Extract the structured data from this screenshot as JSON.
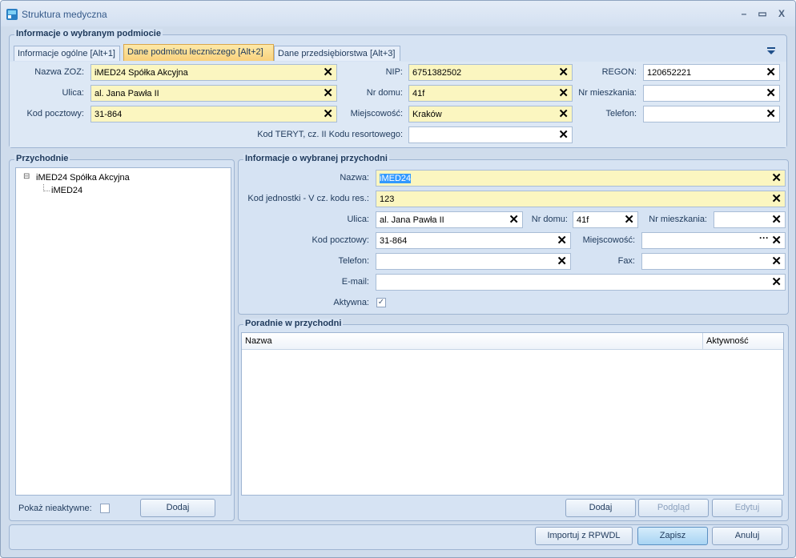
{
  "window": {
    "title": "Struktura medyczna",
    "controls": [
      "–",
      "▭",
      "X"
    ]
  },
  "entity_group": {
    "legend": "Informacje o wybranym podmiocie",
    "tabs": [
      {
        "label": "Informacje ogólne [Alt+1]",
        "active": false
      },
      {
        "label": "Dane podmiotu leczniczego [Alt+2]",
        "active": true
      },
      {
        "label": "Dane przedsiębiorstwa [Alt+3]",
        "active": false
      }
    ],
    "fields": {
      "nazwa_zoz": {
        "label": "Nazwa ZOZ:",
        "value": "iMED24 Spółka Akcyjna"
      },
      "ulica": {
        "label": "Ulica:",
        "value": "al. Jana Pawła II"
      },
      "kod_pocztowy": {
        "label": "Kod pocztowy:",
        "value": "31-864"
      },
      "nip": {
        "label": "NIP:",
        "value": "6751382502"
      },
      "nr_domu": {
        "label": "Nr domu:",
        "value": "41f"
      },
      "miejscowosc": {
        "label": "Miejscowość:",
        "value": "Kraków"
      },
      "regon": {
        "label": "REGON:",
        "value": "120652221"
      },
      "nr_mieszkania": {
        "label": "Nr mieszkania:",
        "value": ""
      },
      "telefon": {
        "label": "Telefon:",
        "value": ""
      },
      "teryt": {
        "label": "Kod TERYT, cz. II Kodu resortowego:",
        "value": ""
      }
    }
  },
  "clinics": {
    "legend": "Przychodnie",
    "tree": [
      {
        "label": "iMED24 Spółka Akcyjna",
        "expander": "⊟"
      },
      {
        "label": "iMED24"
      }
    ],
    "show_inactive_label": "Pokaż nieaktywne:",
    "add_label": "Dodaj"
  },
  "clinic_info": {
    "legend": "Informacje o wybranej przychodni",
    "fields": {
      "nazwa": {
        "label": "Nazwa:",
        "value": "iMED24"
      },
      "kod_jednostki": {
        "label": "Kod jednostki - V cz. kodu res.:",
        "value": "123"
      },
      "ulica": {
        "label": "Ulica:",
        "value": "al. Jana Pawła II"
      },
      "nr_domu": {
        "label": "Nr domu:",
        "value": "41f"
      },
      "nr_mieszkania": {
        "label": "Nr mieszkania:",
        "value": ""
      },
      "kod_pocztowy": {
        "label": "Kod pocztowy:",
        "value": "31-864"
      },
      "miejscowosc": {
        "label": "Miejscowość:",
        "value": ""
      },
      "telefon": {
        "label": "Telefon:",
        "value": ""
      },
      "fax": {
        "label": "Fax:",
        "value": ""
      },
      "email": {
        "label": "E-mail:",
        "value": ""
      },
      "aktywna": {
        "label": "Aktywna:",
        "checked": true
      }
    }
  },
  "departments": {
    "legend": "Poradnie w przychodni",
    "columns": [
      "Nazwa",
      "Aktywność"
    ],
    "buttons": {
      "add": "Dodaj",
      "preview": "Podgląd",
      "edit": "Edytuj"
    }
  },
  "footer": {
    "import": "Importuj z RPWDL",
    "save": "Zapisz",
    "cancel": "Anuluj"
  },
  "colors": {
    "required_field": "#fbf6c0",
    "active_tab": "#f9d17c",
    "selection": "#3399ff"
  }
}
